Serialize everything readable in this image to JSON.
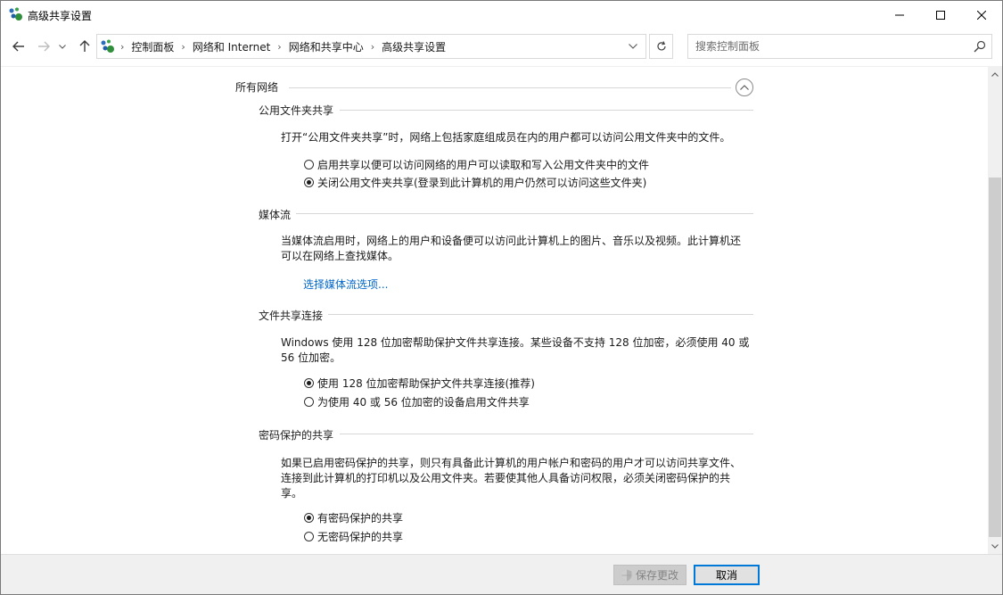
{
  "window": {
    "title": "高级共享设置"
  },
  "navbar": {
    "breadcrumbs": [
      "控制面板",
      "网络和 Internet",
      "网络和共享中心",
      "高级共享设置"
    ],
    "search_placeholder": "搜索控制面板"
  },
  "content": {
    "group_title": "所有网络",
    "public_folder": {
      "title": "公用文件夹共享",
      "description": "打开“公用文件夹共享”时，网络上包括家庭组成员在内的用户都可以访问公用文件夹中的文件。",
      "options": [
        {
          "label": "启用共享以便可以访问网络的用户可以读取和写入公用文件夹中的文件",
          "selected": false
        },
        {
          "label": "关闭公用文件夹共享(登录到此计算机的用户仍然可以访问这些文件夹)",
          "selected": true
        }
      ]
    },
    "media_streaming": {
      "title": "媒体流",
      "description_line1": "当媒体流启用时，网络上的用户和设备便可以访问此计算机上的图片、音乐以及视频。此计算机还",
      "description_line2": "可以在网络上查找媒体。",
      "link": "选择媒体流选项..."
    },
    "file_sharing": {
      "title": "文件共享连接",
      "description_line1": "Windows 使用 128 位加密帮助保护文件共享连接。某些设备不支持 128 位加密，必须使用 40 或",
      "description_line2": "56 位加密。",
      "options": [
        {
          "label": "使用 128 位加密帮助保护文件共享连接(推荐)",
          "selected": true
        },
        {
          "label": "为使用 40 或 56 位加密的设备启用文件共享",
          "selected": false
        }
      ]
    },
    "password_protected": {
      "title": "密码保护的共享",
      "description_line1": "如果已启用密码保护的共享，则只有具备此计算机的用户帐户和密码的用户才可以访问共享文件、",
      "description_line2": "连接到此计算机的打印机以及公用文件夹。若要使其他人具备访问权限，必须关闭密码保护的共",
      "description_line3": "享。",
      "options": [
        {
          "label": "有密码保护的共享",
          "selected": true
        },
        {
          "label": "无密码保护的共享",
          "selected": false
        }
      ]
    }
  },
  "footer": {
    "save_label": "保存更改",
    "cancel_label": "取消"
  },
  "icons": {
    "app": "network-icon",
    "back": "back-arrow-icon",
    "forward": "forward-arrow-icon",
    "recent": "chevron-down-icon",
    "up": "up-arrow-icon",
    "refresh": "refresh-icon",
    "search": "search-icon",
    "collapse": "chevron-up-icon",
    "shield": "uac-shield-icon"
  },
  "colors": {
    "link": "#0066cc",
    "accent": "#0078d7"
  }
}
